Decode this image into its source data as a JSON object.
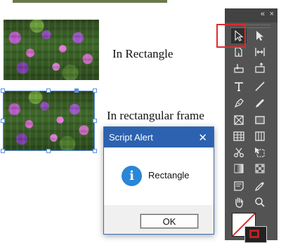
{
  "document": {
    "caption_1": "In Rectangle",
    "caption_2": "In rectangular frame"
  },
  "tools_panel": {
    "collapse_glyph": "«",
    "close_glyph": "×",
    "tools": [
      "selection-icon",
      "direct-selection-icon",
      "page-icon",
      "gap-icon",
      "content-collector-icon",
      "content-placer-icon",
      "type-icon",
      "line-icon",
      "pen-icon",
      "pencil-icon",
      "rectangle-frame-icon",
      "rectangle-icon",
      "table-icon",
      "grid-icon",
      "scissors-icon",
      "free-transform-icon",
      "gradient-swatch-icon",
      "gradient-feather-icon",
      "note-icon",
      "eyedropper-icon",
      "hand-icon",
      "zoom-icon"
    ],
    "active_tool": "selection-icon",
    "highlight_color": "#e02a2a"
  },
  "dialog": {
    "title": "Script Alert",
    "close_glyph": "✕",
    "message": "Rectangle",
    "ok_label": "OK",
    "title_bar_color": "#2c62b0"
  }
}
